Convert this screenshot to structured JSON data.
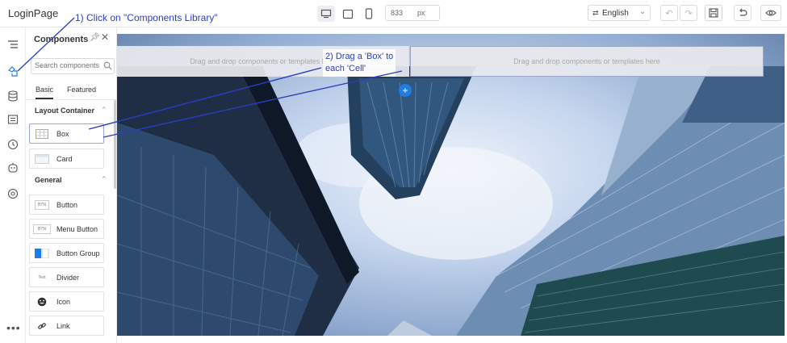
{
  "app": {
    "title": "LoginPage"
  },
  "annotations": {
    "step1": "1) Click on \"Components Library\"",
    "step2_line1": "2) Drag a 'Box' to",
    "step2_line2": "each 'Cell'"
  },
  "toolbar": {
    "devices": [
      "desktop-icon",
      "tablet-icon",
      "mobile-icon"
    ],
    "width_value": "833",
    "width_unit": "px",
    "language": "English",
    "language_icon": "translate-icon",
    "buttons": [
      "undo-icon",
      "redo-icon",
      "save-icon",
      "revert-icon",
      "preview-eye-icon"
    ]
  },
  "rail": {
    "icons": [
      "outline-tree-icon",
      "components-library-icon",
      "data-source-icon",
      "page-settings-icon",
      "history-icon",
      "robot-icon",
      "variables-icon"
    ],
    "more": "•••"
  },
  "panel": {
    "title": "Components",
    "search_placeholder": "Search components",
    "tabs": {
      "basic": "Basic",
      "featured": "Featured"
    },
    "sections": {
      "layout": "Layout Container",
      "general": "General"
    },
    "layout_items": [
      {
        "label": "Box",
        "icon": "box-grid-icon"
      },
      {
        "label": "Card",
        "icon": "card-icon"
      }
    ],
    "general_items": [
      {
        "label": "Button",
        "icon": "button-icon",
        "icon_text": "BTN"
      },
      {
        "label": "Menu Button",
        "icon": "menu-button-icon",
        "icon_text": "BTN"
      },
      {
        "label": "Button Group",
        "icon": "button-group-icon"
      },
      {
        "label": "Divider",
        "icon": "divider-icon",
        "icon_text": "Text"
      },
      {
        "label": "Icon",
        "icon": "smiley-icon"
      },
      {
        "label": "Link",
        "icon": "link-icon"
      }
    ]
  },
  "canvas": {
    "cell_left_text": "Drag and drop components or templates here",
    "cell_right_text": "Drag and drop components or templates here",
    "add_button": "+"
  },
  "colors": {
    "annotation": "#2a3fbf",
    "accent": "#1e7ce6"
  }
}
